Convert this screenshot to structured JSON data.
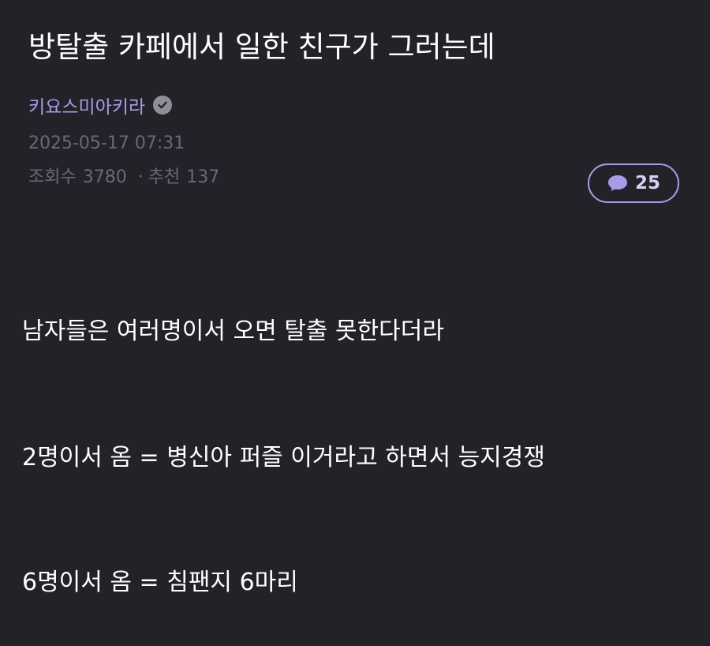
{
  "post": {
    "title": "방탈출 카페에서 일한 친구가 그러는데",
    "author": "키요스미아키라",
    "date": "2025-05-17 07:31",
    "views_label": "조회수",
    "views": "3780",
    "separator": "·",
    "recommend_label": "추천",
    "recommend": "137",
    "comment_count": "25",
    "body_lines": [
      "남자들은 여러명이서 오면 탈출 못한다더라",
      "2명이서 옴 = 병신아 퍼즐 이거라고 하면서 능지경쟁",
      "6명이서 옴 = 침팬지 6마리"
    ]
  },
  "icons": {
    "verified": "check-circle-icon",
    "comment": "speech-bubble-icon"
  },
  "colors": {
    "background": "#232229",
    "accent": "#a99be6",
    "meta_text": "#6a6879",
    "body_text": "#ffffff"
  }
}
